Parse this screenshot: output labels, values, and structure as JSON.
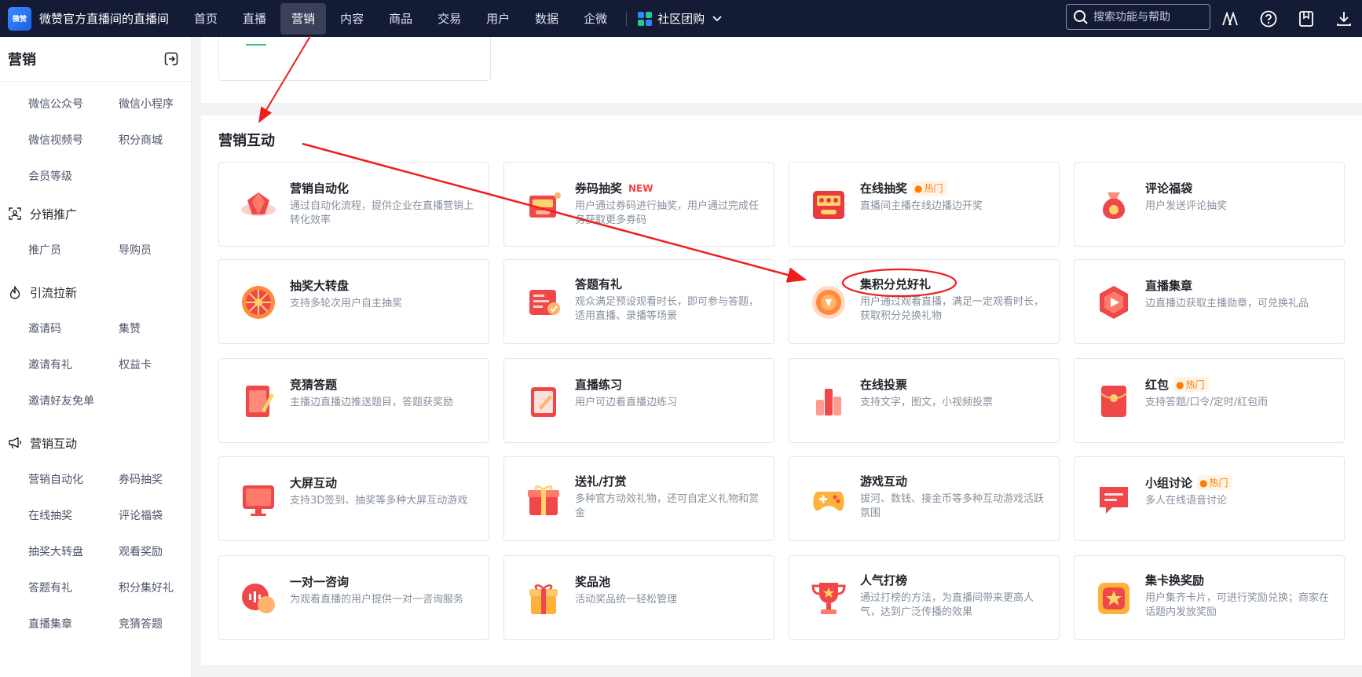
{
  "topbar": {
    "logo_text": "微赞",
    "brand": "微赞官方直播间的直播间",
    "nav": [
      {
        "label": "首页"
      },
      {
        "label": "直播"
      },
      {
        "label": "营销"
      },
      {
        "label": "内容"
      },
      {
        "label": "商品"
      },
      {
        "label": "交易"
      },
      {
        "label": "用户"
      },
      {
        "label": "数据"
      },
      {
        "label": "企微"
      }
    ],
    "active_nav": "营销",
    "community_label": "社区团购",
    "search_placeholder": "搜索功能与帮助",
    "icons": [
      "font-icon",
      "help-icon",
      "bookmark-icon",
      "download-icon"
    ]
  },
  "sidebar": {
    "title": "营销",
    "group1": [
      "微信公众号",
      "微信小程序",
      "微信视频号",
      "积分商城",
      "会员等级"
    ],
    "sections": [
      {
        "title": "分销推广",
        "icon": "distribution-icon",
        "items": [
          "推广员",
          "导购员"
        ]
      },
      {
        "title": "引流拉新",
        "icon": "flame-icon",
        "items": [
          "邀请码",
          "集赞",
          "邀请有礼",
          "权益卡",
          "邀请好友免单"
        ]
      },
      {
        "title": "营销互动",
        "icon": "megaphone-icon",
        "items": [
          "营销自动化",
          "券码抽奖",
          "在线抽奖",
          "评论福袋",
          "抽奖大转盘",
          "观看奖励",
          "答题有礼",
          "积分集好礼",
          "直播集章",
          "竞猜答题"
        ]
      }
    ]
  },
  "main": {
    "section_title": "营销互动",
    "cards": [
      {
        "title": "营销自动化",
        "desc": "通过自动化流程，提供企业在直播营销上转化效率",
        "icon": "automation-icon"
      },
      {
        "title": "券码抽奖",
        "desc": "用户通过券码进行抽奖，用户通过完成任务获取更多券码",
        "badge": "NEW",
        "icon": "coupon-lottery-icon"
      },
      {
        "title": "在线抽奖",
        "desc": "直播间主播在线边播边开奖",
        "hot": "热门",
        "icon": "online-lottery-icon"
      },
      {
        "title": "评论福袋",
        "desc": "用户发送评论抽奖",
        "icon": "lucky-bag-icon"
      },
      {
        "title": "抽奖大转盘",
        "desc": "支持多轮次用户自主抽奖",
        "icon": "wheel-icon"
      },
      {
        "title": "答题有礼",
        "desc": "观众满足预设观看时长，即可参与答题，适用直播、录播等场景",
        "icon": "quiz-icon"
      },
      {
        "title": "集积分兑好礼",
        "desc": "用户通过观看直播，满足一定观看时长，获取积分兑换礼物",
        "icon": "points-icon"
      },
      {
        "title": "直播集章",
        "desc": "边直播边获取主播勋章，可兑换礼品",
        "icon": "stamp-icon"
      },
      {
        "title": "竞猜答题",
        "desc": "主播边直播边推送题目，答题获奖励",
        "icon": "guess-icon"
      },
      {
        "title": "直播练习",
        "desc": "用户可边看直播边练习",
        "icon": "practice-icon"
      },
      {
        "title": "在线投票",
        "desc": "支持文字，图文，小视频投票",
        "icon": "vote-icon"
      },
      {
        "title": "红包",
        "desc": "支持答题/口令/定时/红包雨",
        "hot": "热门",
        "icon": "red-envelope-icon"
      },
      {
        "title": "大屏互动",
        "desc": "支持3D签到、抽奖等多种大屏互动游戏",
        "icon": "big-screen-icon"
      },
      {
        "title": "送礼/打赏",
        "desc": "多种官方动效礼物，还可自定义礼物和赏金",
        "icon": "gift-icon"
      },
      {
        "title": "游戏互动",
        "desc": "拔河、数钱、接金币等多种互动游戏活跃氛围",
        "icon": "game-icon"
      },
      {
        "title": "小组讨论",
        "desc": "多人在线语音讨论",
        "hot": "热门",
        "icon": "group-chat-icon"
      },
      {
        "title": "一对一咨询",
        "desc": "为观看直播的用户提供一对一咨询服务",
        "icon": "consult-icon"
      },
      {
        "title": "奖品池",
        "desc": "活动奖品统一轻松管理",
        "icon": "prize-pool-icon"
      },
      {
        "title": "人气打榜",
        "desc": "通过打榜的方法，为直播间带来更高人气，达到广泛传播的效果",
        "icon": "trophy-icon"
      },
      {
        "title": "集卡换奖励",
        "desc": "用户集齐卡片，可进行奖励兑换；商家在话题内发放奖励",
        "icon": "card-collect-icon"
      }
    ]
  },
  "colors": {
    "topbar": "#141b35",
    "accent_red": "#f53f3f",
    "hot_orange": "#ff7d00",
    "icon_red": "#f0484a"
  }
}
